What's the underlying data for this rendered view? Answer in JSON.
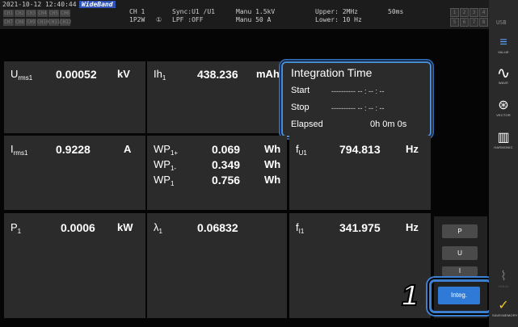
{
  "status": {
    "datetime": "2021-10-12 12:40:44",
    "mode_badge": "WideBand",
    "ch_labels": [
      "CH1",
      "CH2",
      "CH3",
      "CH4",
      "CH5",
      "CH6",
      "CH7",
      "CH8",
      "CH9",
      "CH10",
      "CH11",
      "CH12"
    ],
    "ch": "CH 1",
    "wiring": "1P2W",
    "sync": "Sync:U1  /U1",
    "lpf": "LPF :OFF",
    "range_v": "Manu  1.5kV",
    "range_a": "Manu  50 A",
    "upper": "Upper:  2MHz",
    "lower": "Lower: 10 Hz",
    "interval": "50ms",
    "box_row1": [
      "1",
      "2",
      "3",
      "4"
    ],
    "box_row2": [
      "5",
      "6",
      "7",
      "8"
    ],
    "usb": "USB"
  },
  "cells": {
    "urms": {
      "label_main": "U",
      "label_sub": "rms1",
      "value": "0.00052",
      "unit": "kV"
    },
    "ih": {
      "label_main": "Ih",
      "label_sub": "1",
      "value": "438.236",
      "unit": "mAh"
    },
    "irms": {
      "label_main": "I",
      "label_sub": "rms1",
      "value": "0.9228",
      "unit": "A"
    },
    "wp": [
      {
        "label_main": "WP",
        "label_sub": "1+",
        "value": "0.069",
        "unit": "Wh"
      },
      {
        "label_main": "WP",
        "label_sub": "1-",
        "value": "0.349",
        "unit": "Wh"
      },
      {
        "label_main": "WP",
        "label_sub": "1",
        "value": "0.756",
        "unit": "Wh"
      }
    ],
    "fu": {
      "label_main": "f",
      "label_sub": "U1",
      "value": "794.813",
      "unit": "Hz"
    },
    "p": {
      "label_main": "P",
      "label_sub": "1",
      "value": "0.0006",
      "unit": "kW"
    },
    "lambda": {
      "label_main": "λ",
      "label_sub": "1",
      "value": "0.06832"
    },
    "fi": {
      "label_main": "f",
      "label_sub": "I1",
      "value": "341.975",
      "unit": "Hz"
    }
  },
  "integration": {
    "title": "Integration Time",
    "start_label": "Start",
    "start_value": "----------    -- : -- : --",
    "stop_label": "Stop",
    "stop_value": "----------    -- : -- : --",
    "elapsed_label": "Elapsed",
    "elapsed_value": "0h  0m  0s"
  },
  "panel_buttons": {
    "p": "P",
    "u": "U",
    "i": "I",
    "integ": "Integ."
  },
  "callout_number": "1",
  "sidebar": {
    "value": {
      "icon": "≡",
      "label": "VALUE"
    },
    "wave": {
      "icon": "∿",
      "label": "WAVE"
    },
    "vector": {
      "icon": "⊛",
      "label": "VECTOR"
    },
    "harmonic": {
      "icon": "▥",
      "label": "HARMONIC"
    },
    "hold": {
      "icon": "⌇",
      "label": "HOLD"
    },
    "saving": {
      "icon": "✓",
      "label": "SAVE/MEMORY"
    }
  },
  "colors": {
    "accent": "#3d7fd0",
    "badge": "#2f52b8",
    "cell_bg": "#2b2b2b"
  }
}
